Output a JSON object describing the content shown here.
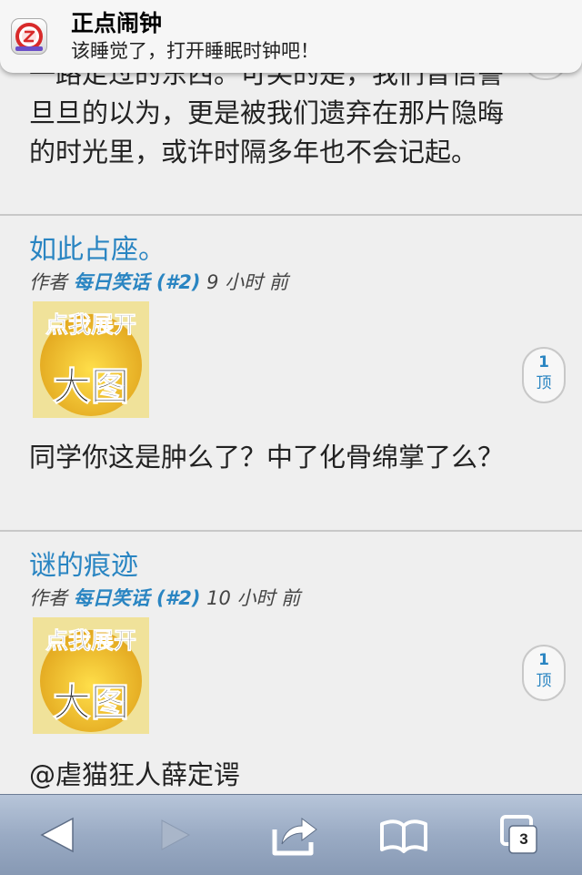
{
  "notification": {
    "app_name": "正点闹钟",
    "message": "该睡觉了，打开睡眠时钟吧！",
    "icon": "alarm-app-icon"
  },
  "partial_post": {
    "text": "一路走过的东西。可笑的是，我们曾信誓旦旦的以为，更是被我们遗弃在那片隐晦的时光里，或许时隔多年也不会记起。"
  },
  "posts": [
    {
      "title": "如此占座。",
      "meta_prefix": "作者",
      "author": "每日笑话 (#2)",
      "time": "9 小时 前",
      "thumbnail_text_top": "点我展开",
      "thumbnail_text_bottom": "大图",
      "body": "同学你这是肿么了？中了化骨绵掌了么？",
      "vote_count": "1",
      "vote_label": "顶"
    },
    {
      "title": "谜的痕迹",
      "meta_prefix": "作者",
      "author": "每日笑话 (#2)",
      "time": "10 小时 前",
      "thumbnail_text_top": "点我展开",
      "thumbnail_text_bottom": "大图",
      "body": "@虐猫狂人薛定谔",
      "vote_count": "1",
      "vote_label": "顶"
    }
  ],
  "toolbar": {
    "buttons": [
      "back-icon",
      "forward-icon",
      "share-icon",
      "bookmarks-icon",
      "tabs-icon"
    ],
    "tab_count": "3"
  },
  "colors": {
    "link": "#2a85c2",
    "toolbar": "#9aabc4",
    "background": "#efefef"
  }
}
